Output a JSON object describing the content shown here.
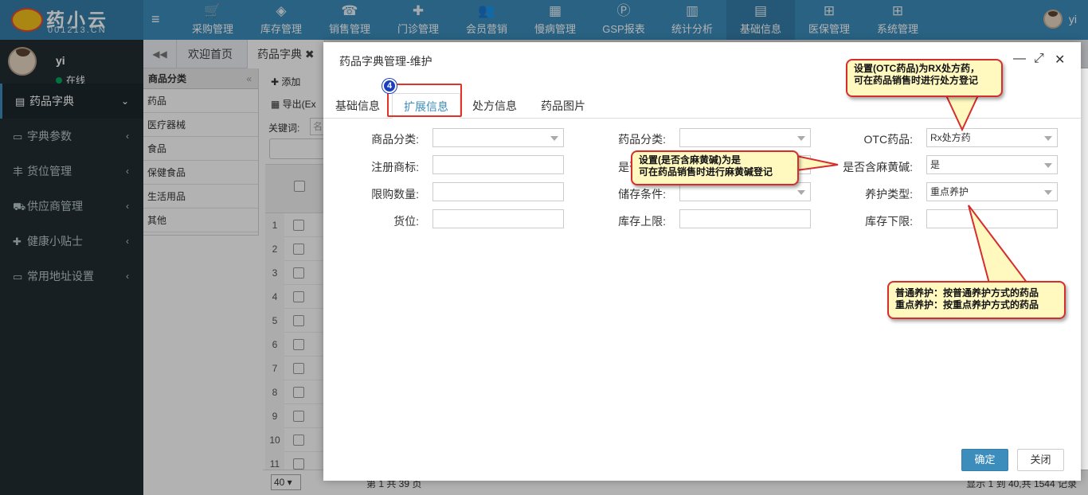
{
  "app": {
    "logo_cn": "药小云",
    "logo_en": "001213.CN",
    "user": "yi",
    "status": "在线"
  },
  "nav": [
    {
      "icon": "cart-icon",
      "glyph": "🛒",
      "label": "采购管理"
    },
    {
      "icon": "cube-icon",
      "glyph": "◈",
      "label": "库存管理"
    },
    {
      "icon": "phone-icon",
      "glyph": "☎",
      "label": "销售管理"
    },
    {
      "icon": "medkit-icon",
      "glyph": "✚",
      "label": "门诊管理"
    },
    {
      "icon": "users-icon",
      "glyph": "👥",
      "label": "会员营销"
    },
    {
      "icon": "building-icon",
      "glyph": "▦",
      "label": "慢病管理"
    },
    {
      "icon": "file-p-icon",
      "glyph": "Ⓟ",
      "label": "GSP报表"
    },
    {
      "icon": "bar-chart-icon",
      "glyph": "▥",
      "label": "统计分析"
    },
    {
      "icon": "book-icon",
      "glyph": "▤",
      "label": "基础信息"
    },
    {
      "icon": "windows-icon",
      "glyph": "⊞",
      "label": "医保管理"
    },
    {
      "icon": "windows-icon",
      "glyph": "⊞",
      "label": "系统管理"
    }
  ],
  "sidebar": [
    {
      "label": "药品字典",
      "glyph": "▤",
      "arrow": "⌄",
      "active": true
    },
    {
      "label": "字典参数",
      "glyph": "▭",
      "arrow": "‹",
      "active": false
    },
    {
      "label": "货位管理",
      "glyph": "丰",
      "arrow": "‹",
      "active": false
    },
    {
      "label": "供应商管理",
      "glyph": "⛟",
      "arrow": "‹",
      "active": false
    },
    {
      "label": "健康小贴士",
      "glyph": "✚",
      "arrow": "‹",
      "active": false
    },
    {
      "label": "常用地址设置",
      "glyph": "▭",
      "arrow": "‹",
      "active": false
    }
  ],
  "tabs": {
    "prev": "◀◀",
    "welcome": "欢迎首页",
    "current": "药品字典 ✖"
  },
  "categories": {
    "title": "商品分类",
    "items": [
      "药品",
      "医疗器械",
      "食品",
      "保健食品",
      "生活用品",
      "其他"
    ]
  },
  "grid": {
    "add": "添加",
    "export": "导出(Ex",
    "keyword": "关键词:",
    "keyword_ph": "名",
    "rows": [
      "1",
      "2",
      "3",
      "4",
      "5",
      "6",
      "7",
      "8",
      "9",
      "10",
      "11"
    ],
    "page_size": "40 ▾",
    "page_info": "第 1 共 39 页",
    "record_info": "显示 1 到 40,共 1544 记录"
  },
  "modal": {
    "title": "药品字典管理-维护",
    "tabs": [
      "基础信息",
      "扩展信息",
      "处方信息",
      "药品图片"
    ],
    "badge": "4",
    "fields": {
      "c1": [
        "商品分类:",
        "注册商标:",
        "限购数量:",
        "货位:"
      ],
      "c2": [
        "药品分类:",
        "是否进口:",
        "储存条件:",
        "库存上限:"
      ],
      "c3": [
        "OTC药品:",
        "是否含麻黄碱:",
        "养护类型:",
        "库存下限:"
      ]
    },
    "values": {
      "otc": "Rx处方药",
      "ephedrine": "是",
      "care": "重点养护"
    },
    "ok": "确定",
    "close": "关闭"
  },
  "callouts": {
    "otc": [
      "设置(OTC药品)为RX处方药，",
      "可在药品销售时进行处方登记"
    ],
    "ephedrine": [
      "设置(是否含麻黄碱)为是",
      "可在药品销售时进行麻黄碱登记"
    ],
    "care": [
      "普通养护：按普通养护方式的药品",
      "重点养护：按重点养护方式的药品"
    ]
  }
}
